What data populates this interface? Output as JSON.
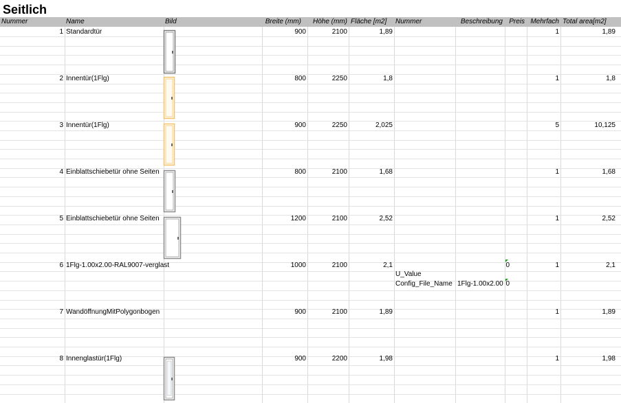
{
  "sheet_title": "Seitlich",
  "headers": {
    "nummer": "Nummer",
    "name": "Name",
    "bild": "Bild",
    "breite": "Breite (mm)",
    "hoehe": "Höhe  (mm)",
    "flaeche": "Fläche [m2]",
    "nummer2": "Nummer",
    "beschreibung": "Beschreibung",
    "preis": "Preis",
    "mehrfach": "Mehrfach",
    "total": "Total area[m2]"
  },
  "rows": [
    {
      "nr": "1",
      "name": "Standardtür",
      "breite": "900",
      "hoehe": "2100",
      "flaeche": "1,89",
      "mehrfach": "1",
      "total": "1,89",
      "image": "door-gray-icon"
    },
    {
      "nr": "2",
      "name": "Innentür(1Flg)",
      "breite": "800",
      "hoehe": "2250",
      "flaeche": "1,8",
      "mehrfach": "1",
      "total": "1,8",
      "image": "door-wood-icon"
    },
    {
      "nr": "3",
      "name": "Innentür(1Flg)",
      "breite": "900",
      "hoehe": "2250",
      "flaeche": "2,025",
      "mehrfach": "5",
      "total": "10,125",
      "image": "door-wood-icon"
    },
    {
      "nr": "4",
      "name": "Einblattschiebetür ohne Seiten",
      "breite": "800",
      "hoehe": "2100",
      "flaeche": "1,68",
      "mehrfach": "1",
      "total": "1,68",
      "image": "sliding-door-icon"
    },
    {
      "nr": "5",
      "name": "Einblattschiebetür ohne Seiten",
      "breite": "1200",
      "hoehe": "2100",
      "flaeche": "2,52",
      "mehrfach": "1",
      "total": "2,52",
      "image": "sliding-door-wide-icon"
    },
    {
      "nr": "6",
      "name": "1Flg-1.00x2.00-RAL9007-verglast",
      "breite": "1000",
      "hoehe": "2100",
      "flaeche": "2,1",
      "preis": "0",
      "mehrfach": "1",
      "total": "2,1",
      "image": ""
    },
    {
      "nr": "7",
      "name": "WandöffnungMitPolygonbogen",
      "breite": "900",
      "hoehe": "2100",
      "flaeche": "1,89",
      "mehrfach": "1",
      "total": "1,89",
      "image": ""
    },
    {
      "nr": "8",
      "name": "Innenglastür(1Flg)",
      "breite": "900",
      "hoehe": "2200",
      "flaeche": "1,98",
      "mehrfach": "1",
      "total": "1,98",
      "image": "glass-door-icon"
    }
  ],
  "extra": {
    "u_value_label": "U_Value",
    "config_label": "Config_File_Name",
    "config_value": "1Flg-1.00x2.00",
    "config_preis": "0"
  },
  "colors": {
    "header_bg": "#c0c0c0",
    "grid": "#d9d9d9",
    "comment_marker": "#1aa31a",
    "wood": "#f2c46d"
  }
}
